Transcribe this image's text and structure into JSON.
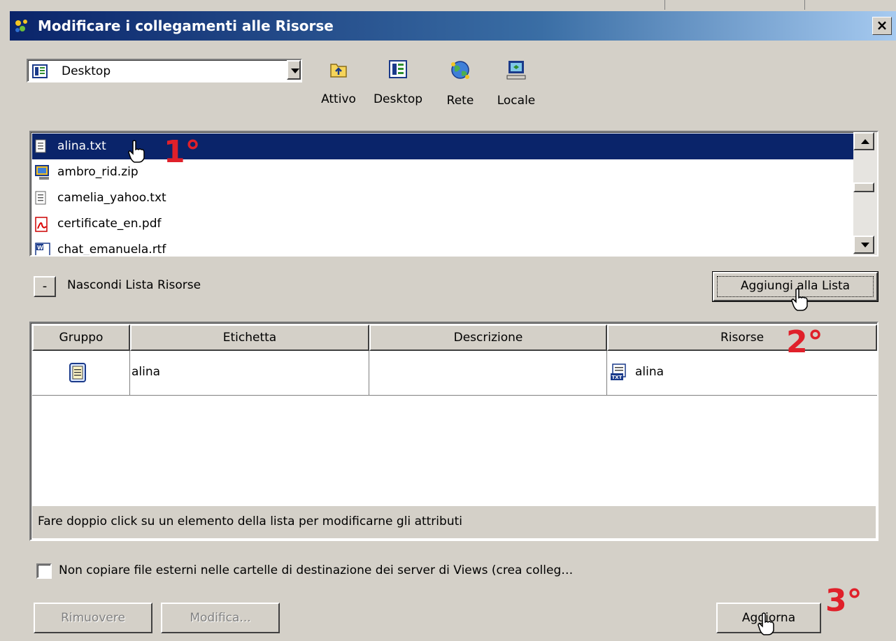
{
  "window": {
    "title": "Modificare i collegamenti alle Risorse",
    "close_glyph": "×"
  },
  "location": {
    "selected": "Desktop"
  },
  "toolbar": [
    {
      "label": "Attivo",
      "icon": "folder-up-icon"
    },
    {
      "label": "Desktop",
      "icon": "desktop-icon"
    },
    {
      "label": "Rete",
      "icon": "network-globe-icon"
    },
    {
      "label": "Locale",
      "icon": "local-computer-icon"
    }
  ],
  "files": [
    {
      "name": "alina.txt",
      "icon": "text-file-icon",
      "selected": true
    },
    {
      "name": "ambro_rid.zip",
      "icon": "monitor-file-icon",
      "selected": false
    },
    {
      "name": "camelia_yahoo.txt",
      "icon": "text-file-icon",
      "selected": false
    },
    {
      "name": "certificate_en.pdf",
      "icon": "pdf-file-icon",
      "selected": false
    },
    {
      "name": "chat_emanuela.rtf",
      "icon": "word-file-icon",
      "selected": false
    }
  ],
  "hide_toggle": {
    "glyph": "-",
    "label": "Nascondi Lista Risorse"
  },
  "add_button": {
    "label": "Aggiungi alla Lista"
  },
  "grid": {
    "columns": [
      "Gruppo",
      "Etichetta",
      "Descrizione",
      "Risorse"
    ],
    "rows": [
      {
        "gruppo_icon": "document-group-icon",
        "etichetta": "alina",
        "descrizione": "",
        "risorse": "alina",
        "risorse_icon": "txt-file-icon"
      }
    ],
    "status": "Fare doppio click su un elemento della lista per modificarne gli attributi"
  },
  "checkbox": {
    "label": "Non copiare file esterni nelle cartelle di destinazione dei server di Views (crea colleg…",
    "checked": false
  },
  "buttons": {
    "remove": "Rimuovere",
    "modify": "Modifica...",
    "update": "Aggiorna"
  },
  "annotations": [
    "1°",
    "2°",
    "3°"
  ]
}
